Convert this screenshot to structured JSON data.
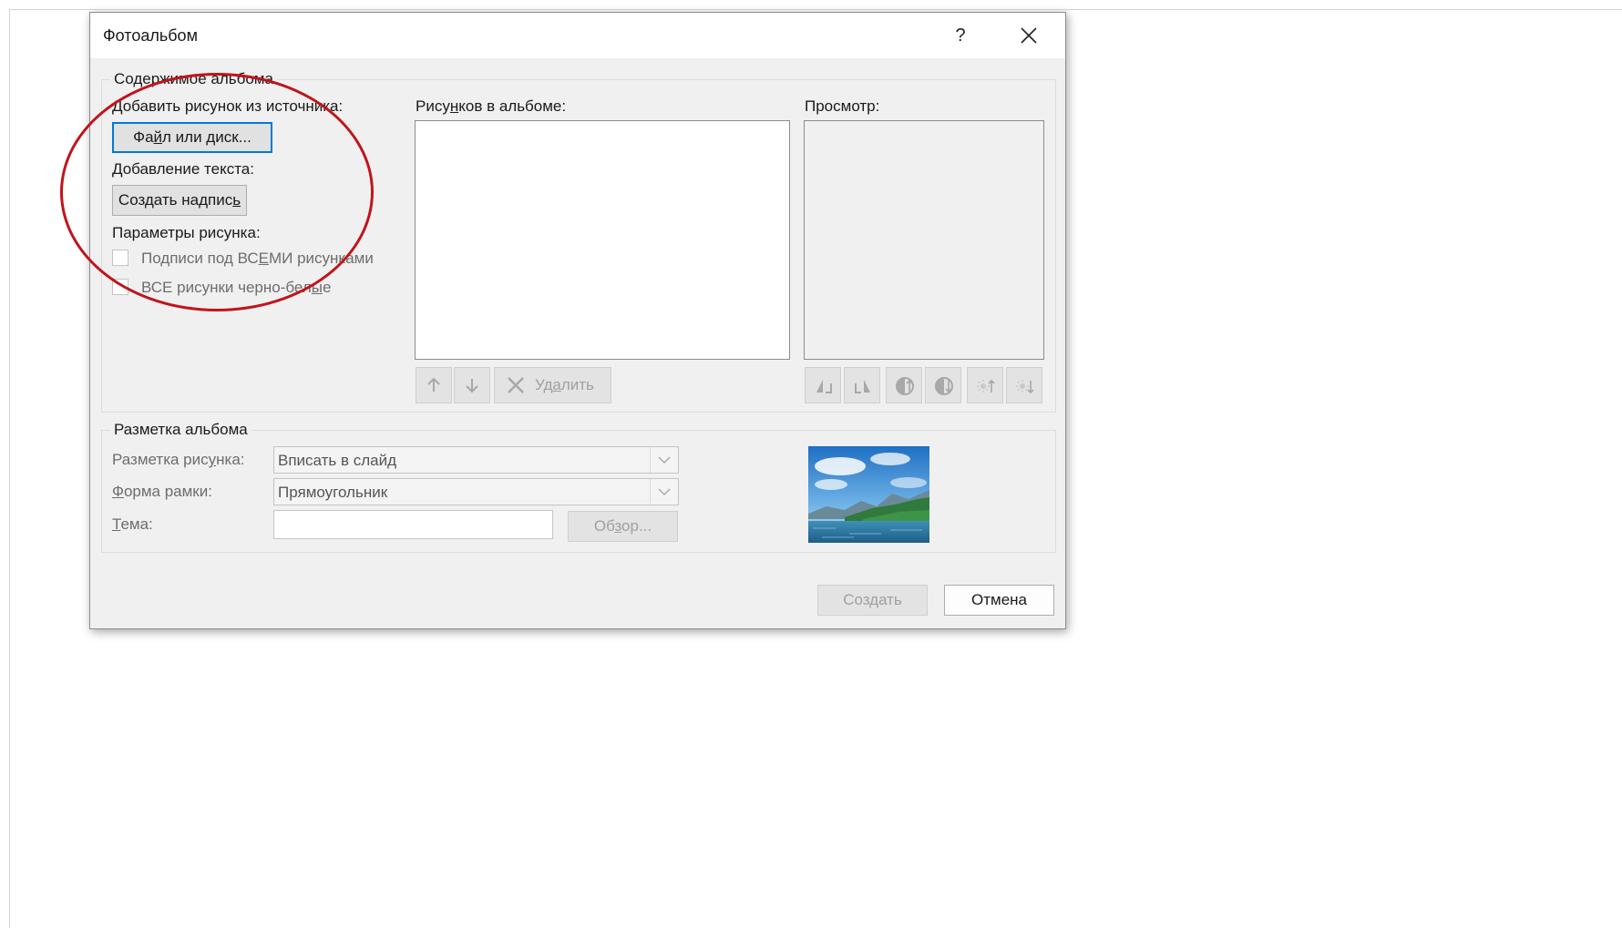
{
  "dialog": {
    "title": "Фотоальбом",
    "help_label": "?",
    "close_icon": "close-icon"
  },
  "album_content": {
    "group_title": "Содержимое альбома",
    "add_picture_label": "Добавить рисунок из источника:",
    "file_button_pre": "Фа",
    "file_button_u": "й",
    "file_button_post": "л или диск...",
    "add_text_label": "Добавление текста:",
    "new_caption_pre": "Создать надпис",
    "new_caption_u": "ь",
    "picture_options_label": "Параметры рисунка:",
    "captions_pre": "Подписи под ВС",
    "captions_u": "Е",
    "captions_post": "МИ рисунками",
    "captions_checked": false,
    "bw_pre": "ВСЕ рисунки черно-бел",
    "bw_u": "ы",
    "bw_post": "е",
    "bw_checked": false,
    "pictures_label_pre": "Рису",
    "pictures_label_u": "н",
    "pictures_label_post": "ков в альбоме:",
    "preview_label": "Просмотр:",
    "remove_pre": "Уд",
    "remove_u": "а",
    "remove_post": "лить"
  },
  "album_layout": {
    "group_title": "Разметка альбома",
    "picture_layout_pre": "Разметка рис",
    "picture_layout_u": "у",
    "picture_layout_post": "нка:",
    "picture_layout_value": "Вписать в слайд",
    "frame_shape_u": "Ф",
    "frame_shape_post": "орма рамки:",
    "frame_shape_value": "Прямоугольник",
    "theme_u": "Т",
    "theme_post": "ема:",
    "theme_value": "",
    "browse_pre": "Об",
    "browse_u": "з",
    "browse_post": "ор..."
  },
  "footer": {
    "create_label": "Создать",
    "cancel_label": "Отмена"
  },
  "colors": {
    "annotation": "#c0141b",
    "focus": "#0078d7"
  }
}
